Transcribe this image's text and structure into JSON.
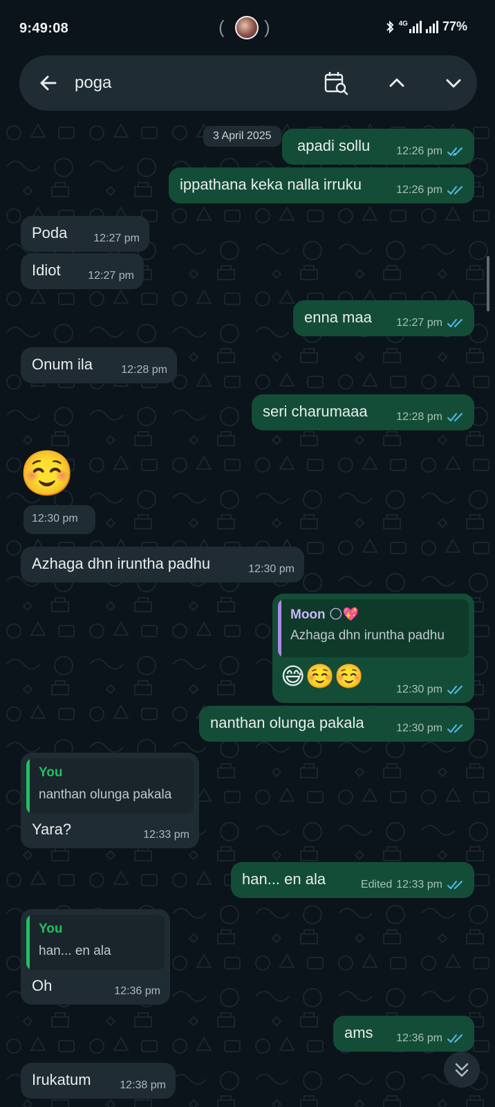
{
  "status_bar": {
    "time": "9:49:08",
    "battery": "77%",
    "network_label": "4G",
    "icons": [
      "bluetooth-icon",
      "signal-icon",
      "signal-icon",
      "battery-icon"
    ]
  },
  "search": {
    "query": "poga",
    "icons": {
      "back": "arrow-left-icon",
      "calendar": "calendar-search-icon",
      "prev": "chevron-up-icon",
      "next": "chevron-down-icon"
    }
  },
  "chat": {
    "date_label": "3 April 2025",
    "messages": [
      {
        "dir": "out",
        "text": "apadi sollu",
        "time": "12:26 pm",
        "read": true
      },
      {
        "dir": "out",
        "text": "ippathana keka nalla irruku",
        "time": "12:26 pm",
        "read": true
      },
      {
        "dir": "in",
        "text": "Poda",
        "time": "12:27 pm"
      },
      {
        "dir": "in",
        "text": "Idiot",
        "time": "12:27 pm"
      },
      {
        "dir": "out",
        "text": "enna maa",
        "time": "12:27 pm",
        "read": true
      },
      {
        "dir": "in",
        "text": "Onum ila",
        "time": "12:28 pm"
      },
      {
        "dir": "out",
        "text": "seri charumaaa",
        "time": "12:28 pm",
        "read": true
      },
      {
        "dir": "in",
        "emoji": "☺️",
        "time": "12:30 pm"
      },
      {
        "dir": "in",
        "text": "Azhaga dhn iruntha padhu",
        "time": "12:30 pm"
      },
      {
        "dir": "out",
        "quote_name": "Moon 🌕💖",
        "quote_text": "Azhaga dhn iruntha padhu",
        "text": "😅☺️☺️",
        "time": "12:30 pm",
        "read": true
      },
      {
        "dir": "out",
        "text": "nanthan olunga pakala",
        "time": "12:30 pm",
        "read": true
      },
      {
        "dir": "in",
        "quote_name": "You",
        "quote_text": "nanthan olunga pakala",
        "text": "Yara?",
        "time": "12:33 pm"
      },
      {
        "dir": "out",
        "text": "han...  en ala",
        "edited": "Edited",
        "time": "12:33 pm",
        "read": true
      },
      {
        "dir": "in",
        "quote_name": "You",
        "quote_text": "han...  en ala",
        "text": "Oh",
        "time": "12:36 pm"
      },
      {
        "dir": "out",
        "text": "ams",
        "time": "12:36 pm",
        "read": true
      },
      {
        "dir": "in",
        "text": "Irukatum",
        "time": "12:38 pm"
      }
    ]
  },
  "colors": {
    "background": "#0b141a",
    "incoming_bubble": "#1f2c33",
    "outgoing_bubble": "#144d37",
    "read_ticks": "#53bdeb",
    "quote_moon_bar": "#a98be8",
    "quote_you_bar": "#21c063"
  }
}
